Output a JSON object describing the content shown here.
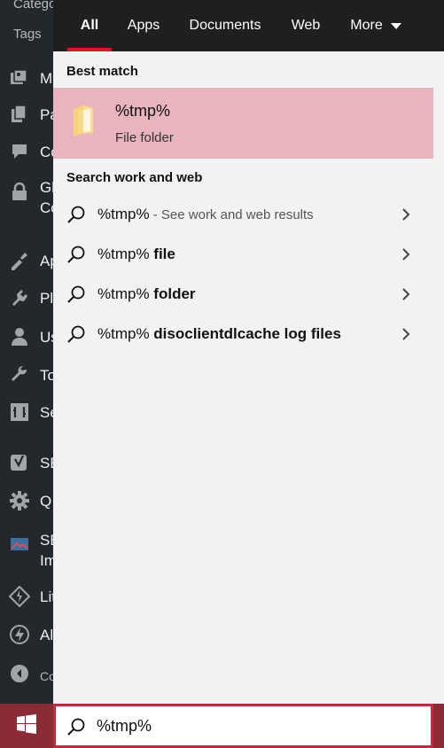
{
  "wp_sidebar": {
    "top_items": [
      "Catego",
      "Tags"
    ],
    "items": [
      {
        "icon": "media-icon",
        "label": "M"
      },
      {
        "icon": "pages-icon",
        "label": "Pa"
      },
      {
        "icon": "comments-icon",
        "label": "Co"
      },
      {
        "icon": "lock-icon",
        "label": "Gl\nCo"
      },
      {
        "icon": "appearance-icon",
        "label": "Ap"
      },
      {
        "icon": "plugins-icon",
        "label": "Pl"
      },
      {
        "icon": "users-icon",
        "label": "Us"
      },
      {
        "icon": "tools-icon",
        "label": "To"
      },
      {
        "icon": "settings-icon",
        "label": "Se"
      },
      {
        "icon": "yoast-icon",
        "label": "SE"
      },
      {
        "icon": "gear-icon",
        "label": "Q"
      },
      {
        "icon": "seo-image-icon",
        "label": "SE\nIm"
      },
      {
        "icon": "litespeed-icon",
        "label": "Lit"
      },
      {
        "icon": "amp-icon",
        "label": "Al"
      },
      {
        "icon": "collapse-icon",
        "label": "Co"
      }
    ]
  },
  "tabs": [
    {
      "label": "All",
      "active": true
    },
    {
      "label": "Apps",
      "active": false
    },
    {
      "label": "Documents",
      "active": false
    },
    {
      "label": "Web",
      "active": false
    },
    {
      "label": "More",
      "active": false
    }
  ],
  "best_match": {
    "heading": "Best match",
    "name": "%tmp%",
    "type": "File folder",
    "icon": "folder-icon"
  },
  "search_web": {
    "heading": "Search work and web",
    "results": [
      {
        "prefix": "%tmp%",
        "suffix": "",
        "hint": " - See work and web results"
      },
      {
        "prefix": "%tmp% ",
        "suffix": "file",
        "hint": ""
      },
      {
        "prefix": "%tmp% ",
        "suffix": "folder",
        "hint": ""
      },
      {
        "prefix": "%tmp% ",
        "suffix": "disoclientdlcache log files",
        "hint": ""
      }
    ]
  },
  "taskbar": {
    "search_value": "%tmp%",
    "start_icon": "windows-logo-icon",
    "accent": "#8b2b35"
  },
  "colors": {
    "highlight": "#e8b4bd",
    "tab_underline": "#e81123",
    "panel_bg": "#f2f2f2",
    "tab_bg": "#1f1f1f"
  }
}
